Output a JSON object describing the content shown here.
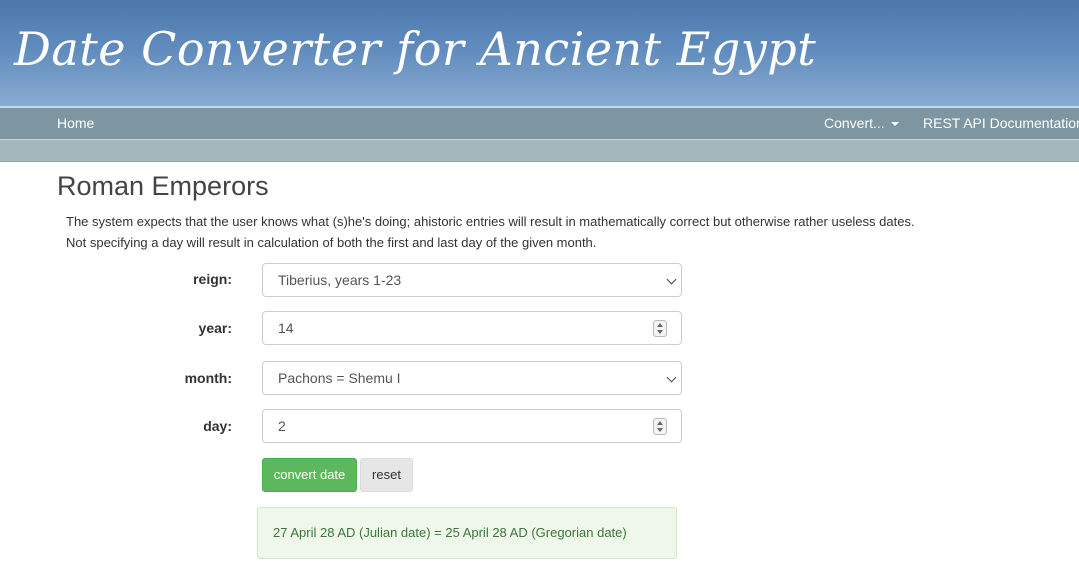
{
  "header": {
    "site_title": "Date Converter for Ancient Egypt"
  },
  "nav": {
    "home": "Home",
    "convert": "Convert...",
    "api_docs": "REST API Documentation"
  },
  "page": {
    "title": "Roman Emperors",
    "intro_line_1": "The system expects that the user knows what (s)he's doing; ahistoric entries will result in mathematically correct but otherwise rather useless dates.",
    "intro_line_2": "Not specifying a day will result in calculation of both the first and last day of the given month."
  },
  "form": {
    "reign": {
      "label": "reign:",
      "value": "Tiberius, years 1-23"
    },
    "year": {
      "label": "year:",
      "value": "14"
    },
    "month": {
      "label": "month:",
      "value": "Pachons = Shemu I"
    },
    "day": {
      "label": "day:",
      "value": "2"
    },
    "convert_button": "convert date",
    "reset_button": "reset"
  },
  "result": {
    "text": "27 April 28 AD (Julian date) = 25 April 28 AD (Gregorian date)"
  },
  "colors": {
    "banner": "#5f8bbd",
    "navbar": "#7d96a1",
    "convert_button": "#5cb85c",
    "result_background": "#eef7e9",
    "result_text": "#3c763d"
  }
}
